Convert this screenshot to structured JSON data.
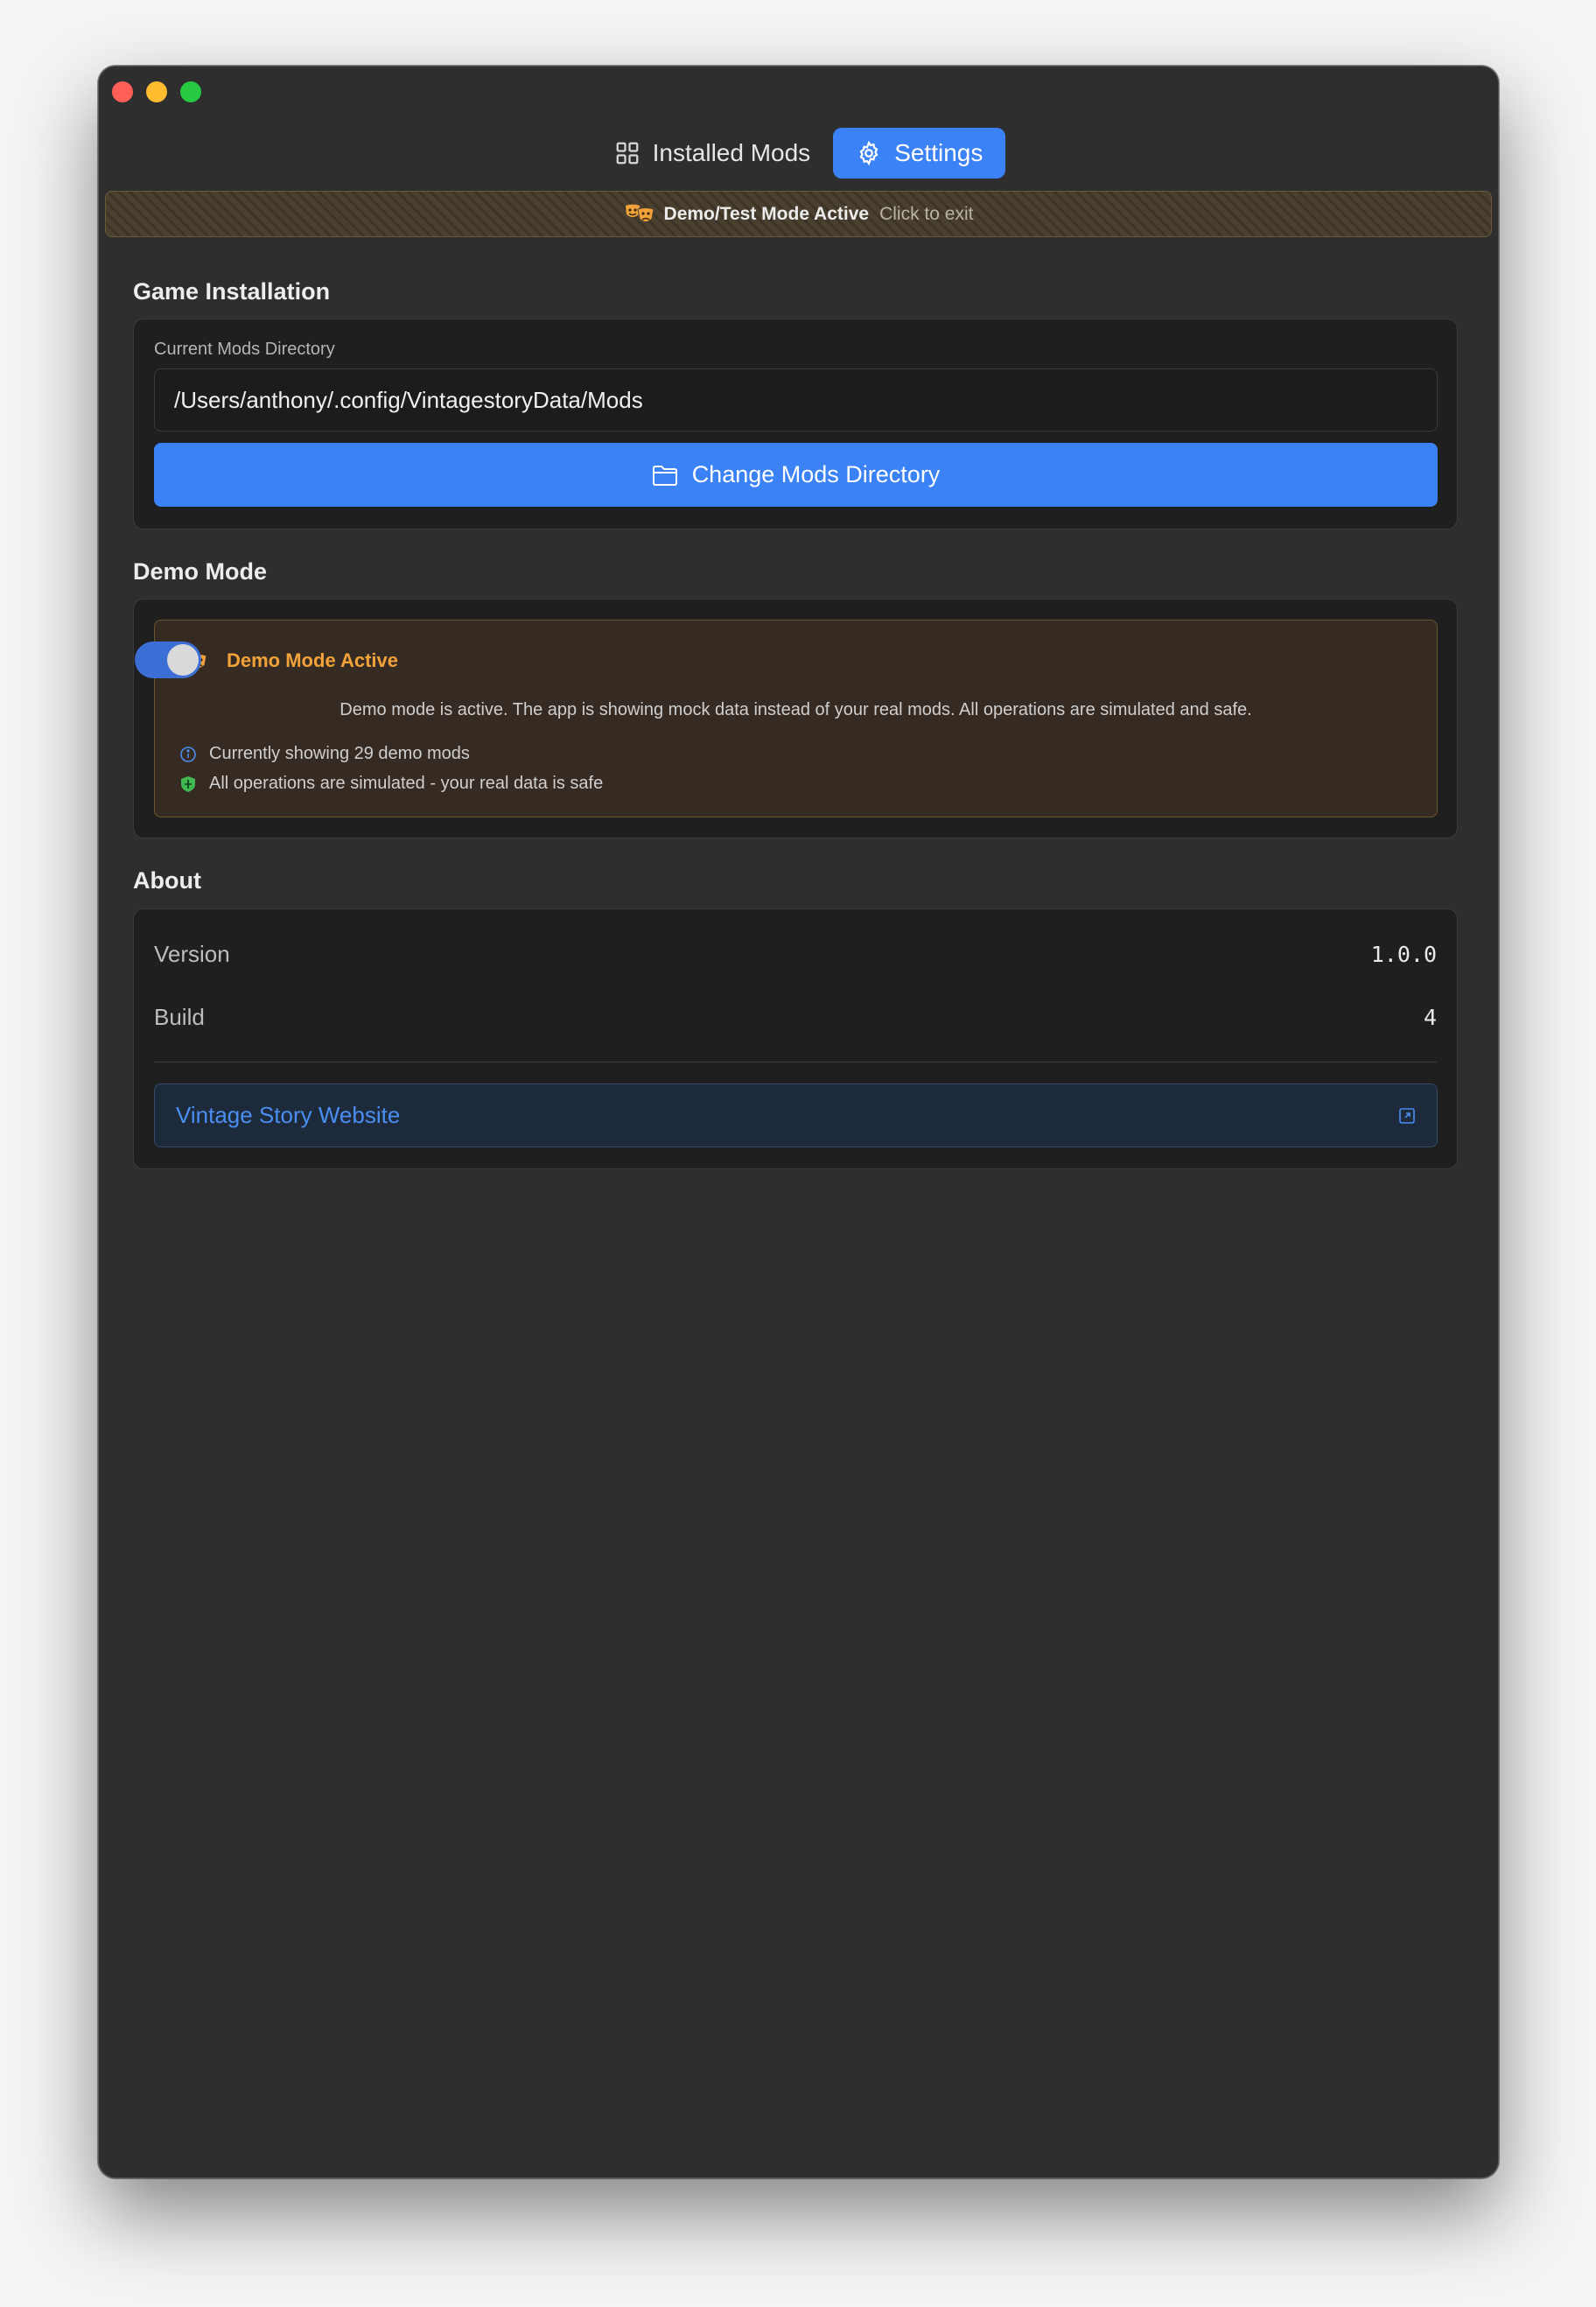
{
  "tabs": [
    {
      "label": "Installed Mods",
      "icon": "grid-icon",
      "active": false
    },
    {
      "label": "Settings",
      "icon": "gear-icon",
      "active": true
    }
  ],
  "banner": {
    "title": "Demo/Test Mode Active",
    "action": "Click to exit"
  },
  "game_installation": {
    "section_title": "Game Installation",
    "field_label": "Current Mods Directory",
    "path_value": "/Users/anthony/.config/VintagestoryData/Mods",
    "change_button": "Change Mods Directory"
  },
  "demo_mode": {
    "section_title": "Demo Mode",
    "heading": "Demo Mode Active",
    "toggle_on": true,
    "description": "Demo mode is active. The app is showing mock data instead of your real mods. All operations are simulated and safe.",
    "info_line": "Currently showing 29 demo mods",
    "safe_line": "All operations are simulated - your real data is safe"
  },
  "about": {
    "section_title": "About",
    "version_label": "Version",
    "version_value": "1.0.0",
    "build_label": "Build",
    "build_value": "4",
    "website_link": "Vintage Story Website"
  },
  "colors": {
    "accent": "#3b82f6",
    "window_bg": "#2e2e2e",
    "card_bg": "#1f1f1f",
    "demo_orange": "#f2a23a"
  }
}
